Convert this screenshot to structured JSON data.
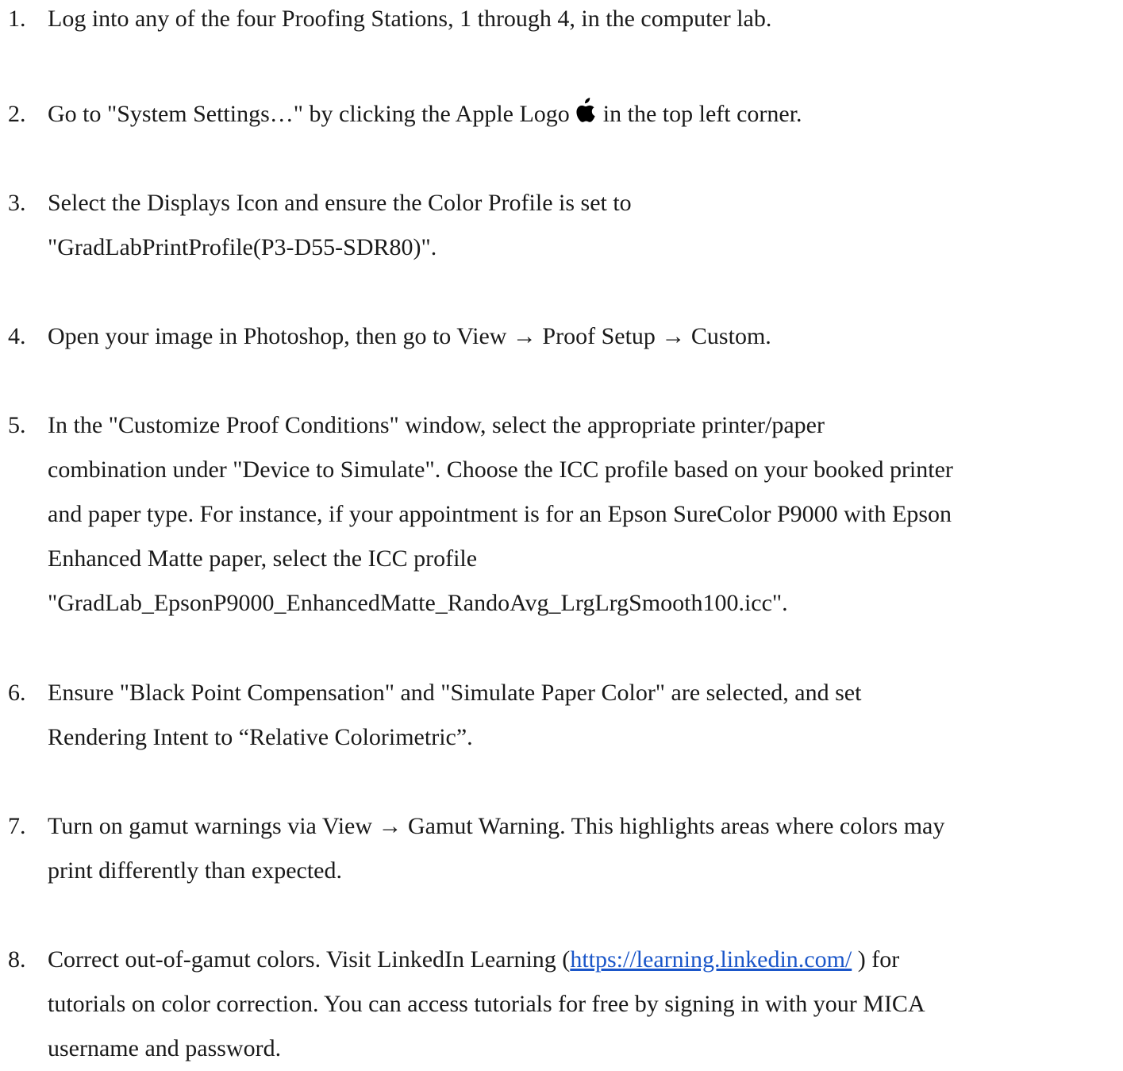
{
  "steps": [
    {
      "number": "1.",
      "lines": [
        "Log into any of the four Proofing Stations, 1 through 4, in the computer lab."
      ]
    },
    {
      "number": "2.",
      "text_before_icon": "Go to \"System Settings…\" by clicking the Apple Logo",
      "icon": "apple-logo-icon",
      "text_after_icon": "in the top left corner."
    },
    {
      "number": "3.",
      "lines": [
        "Select the Displays Icon and ensure the Color Profile is set to",
        "\"GradLabPrintProfile(P3-D55-SDR80)\"."
      ]
    },
    {
      "number": "4.",
      "lines": [
        "Open your image in Photoshop, then go to View → Proof Setup → Custom."
      ]
    },
    {
      "number": "5.",
      "lines": [
        "In the \"Customize Proof Conditions\" window, select the appropriate printer/paper",
        "combination under \"Device to Simulate\". Choose the ICC profile based on your booked printer",
        "and paper type. For instance, if your appointment is for an Epson SureColor P9000 with Epson",
        "Enhanced Matte paper, select the ICC profile",
        "\"GradLab_EpsonP9000_EnhancedMatte_RandoAvg_LrgLrgSmooth100.icc\"."
      ]
    },
    {
      "number": "6.",
      "lines": [
        "Ensure \"Black Point Compensation\" and \"Simulate Paper Color\" are selected, and set",
        "Rendering Intent to “Relative Colorimetric”."
      ]
    },
    {
      "number": "7.",
      "lines": [
        "Turn on gamut warnings via View → Gamut Warning. This highlights areas where colors may",
        "print differently than expected."
      ]
    },
    {
      "number": "8.",
      "line1_before_link": "Correct out-of-gamut colors. Visit LinkedIn Learning (",
      "link_text": "https://learning.linkedin.com/",
      "line1_after_link": " ) for",
      "lines_after": [
        "tutorials on color correction. You can access tutorials for free by signing in with your MICA",
        "username and password."
      ]
    }
  ],
  "colors": {
    "text": "#1a1a1a",
    "link": "#1a56c9"
  }
}
